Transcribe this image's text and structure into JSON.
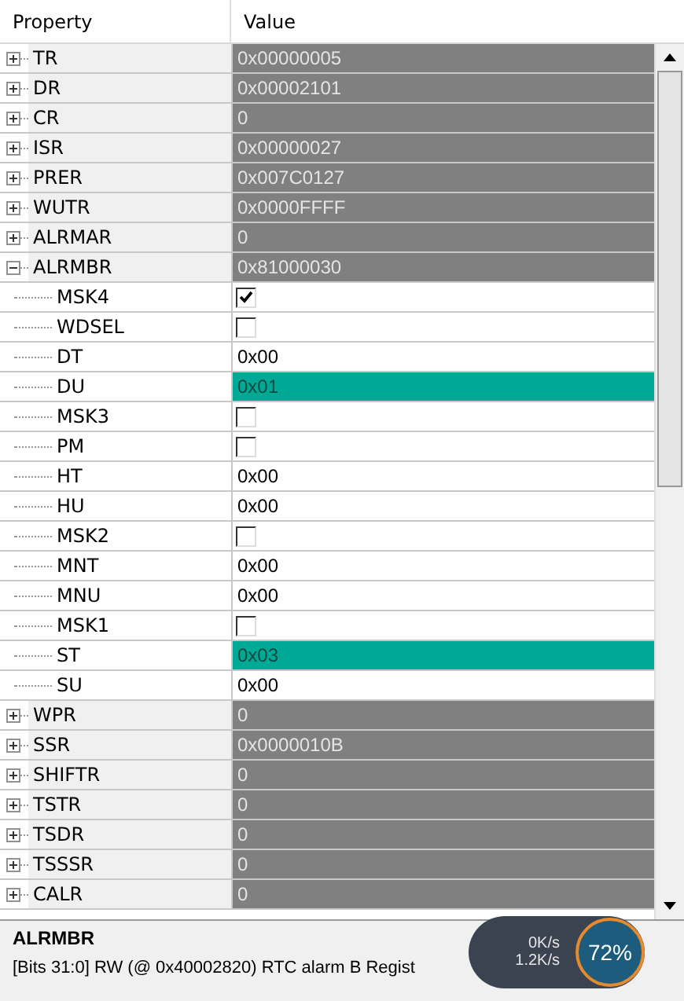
{
  "columns": [
    "Property",
    "Value"
  ],
  "registers": [
    {
      "name": "TR",
      "value": "0x00000005",
      "expanded": false
    },
    {
      "name": "DR",
      "value": "0x00002101",
      "expanded": false
    },
    {
      "name": "CR",
      "value": "0",
      "expanded": false
    },
    {
      "name": "ISR",
      "value": "0x00000027",
      "expanded": false
    },
    {
      "name": "PRER",
      "value": "0x007C0127",
      "expanded": false
    },
    {
      "name": "WUTR",
      "value": "0x0000FFFF",
      "expanded": false
    },
    {
      "name": "ALRMAR",
      "value": "0",
      "expanded": false
    },
    {
      "name": "ALRMBR",
      "value": "0x81000030",
      "expanded": true,
      "children": [
        {
          "name": "MSK4",
          "kind": "checkbox",
          "checked": true
        },
        {
          "name": "WDSEL",
          "kind": "checkbox",
          "checked": false
        },
        {
          "name": "DT",
          "kind": "hex",
          "value": "0x00",
          "changed": false
        },
        {
          "name": "DU",
          "kind": "hex",
          "value": "0x01",
          "changed": true
        },
        {
          "name": "MSK3",
          "kind": "checkbox",
          "checked": false
        },
        {
          "name": "PM",
          "kind": "checkbox",
          "checked": false
        },
        {
          "name": "HT",
          "kind": "hex",
          "value": "0x00",
          "changed": false
        },
        {
          "name": "HU",
          "kind": "hex",
          "value": "0x00",
          "changed": false
        },
        {
          "name": "MSK2",
          "kind": "checkbox",
          "checked": false
        },
        {
          "name": "MNT",
          "kind": "hex",
          "value": "0x00",
          "changed": false
        },
        {
          "name": "MNU",
          "kind": "hex",
          "value": "0x00",
          "changed": false
        },
        {
          "name": "MSK1",
          "kind": "checkbox",
          "checked": false
        },
        {
          "name": "ST",
          "kind": "hex",
          "value": "0x03",
          "changed": true
        },
        {
          "name": "SU",
          "kind": "hex",
          "value": "0x00",
          "changed": false
        }
      ]
    },
    {
      "name": "WPR",
      "value": "0",
      "expanded": false
    },
    {
      "name": "SSR",
      "value": "0x0000010B",
      "expanded": false
    },
    {
      "name": "SHIFTR",
      "value": "0",
      "expanded": false
    },
    {
      "name": "TSTR",
      "value": "0",
      "expanded": false
    },
    {
      "name": "TSDR",
      "value": "0",
      "expanded": false
    },
    {
      "name": "TSSSR",
      "value": "0",
      "expanded": false
    },
    {
      "name": "CALR",
      "value": "0",
      "expanded": false
    }
  ],
  "description": {
    "title": "ALRMBR",
    "text": "[Bits 31:0] RW (@ 0x40002820) RTC alarm B Regist"
  },
  "net_widget": {
    "upload": "0K/s",
    "download": "1.2K/s",
    "percent": "72%"
  }
}
